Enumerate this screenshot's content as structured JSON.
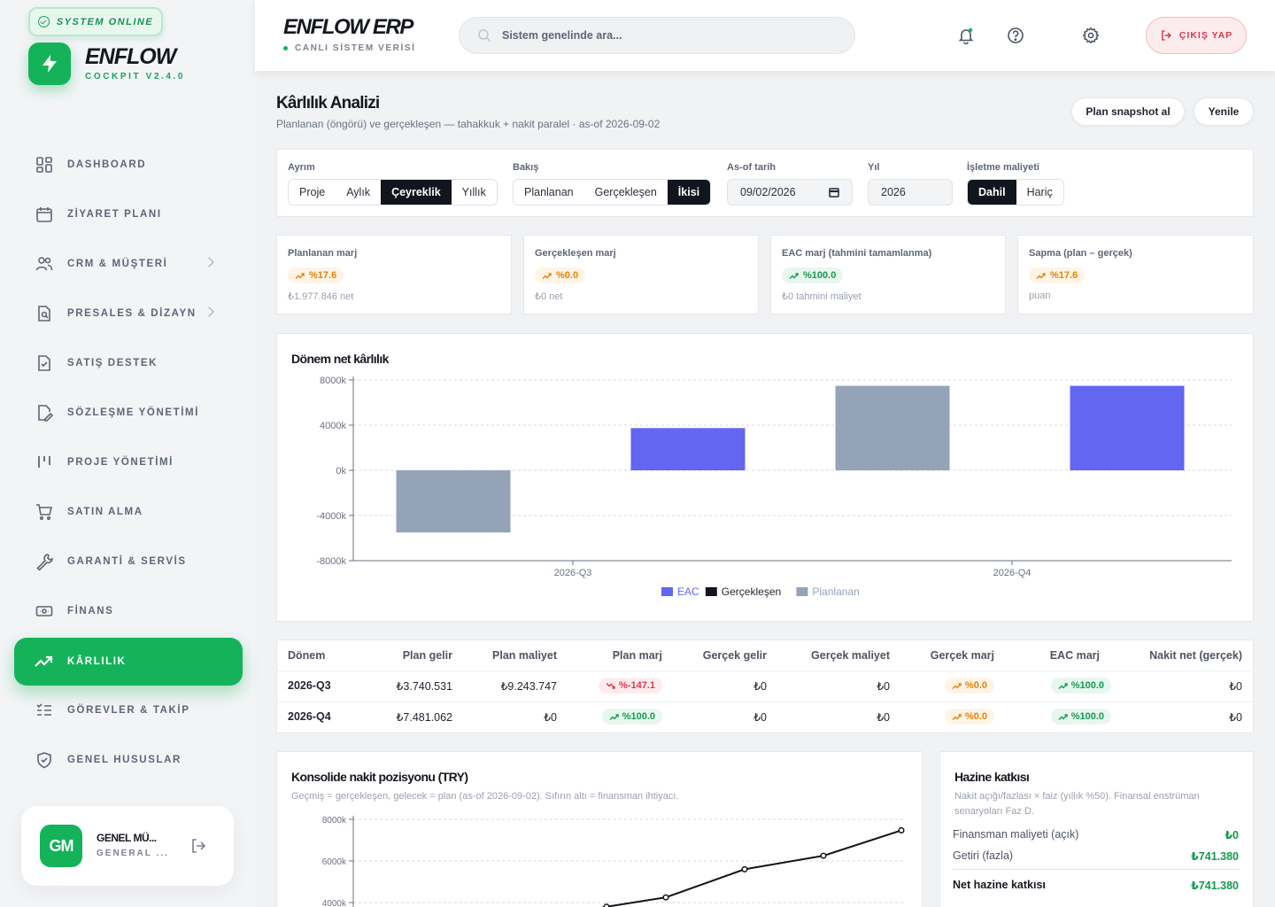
{
  "sidebar": {
    "status": "SYSTEM ONLINE",
    "brand": "ENFLOW",
    "version": "COCKPIT V2.4.0",
    "items": [
      {
        "label": "DASHBOARD"
      },
      {
        "label": "ZİYARET PLANI"
      },
      {
        "label": "CRM & MÜŞTERİ"
      },
      {
        "label": "PRESALES & DİZAYN"
      },
      {
        "label": "SATIŞ DESTEK"
      },
      {
        "label": "SÖZLEŞME YÖNETİMİ"
      },
      {
        "label": "PROJE YÖNETİMİ"
      },
      {
        "label": "SATIN ALMA"
      },
      {
        "label": "GARANTİ & SERVİS"
      },
      {
        "label": "FİNANS"
      },
      {
        "label": "KÂRLILIK"
      },
      {
        "label": "GÖREVLER & TAKİP"
      },
      {
        "label": "GENEL HUSUSLAR"
      }
    ],
    "user": {
      "initials": "GM",
      "name": "GENEL MÜ...",
      "role": "GENERAL ..."
    }
  },
  "topbar": {
    "logo": "ENFLOW ERP",
    "subtitle": "CANLI SİSTEM VERİSİ",
    "search_placeholder": "Sistem genelinde ara...",
    "logout": "ÇIKIŞ YAP"
  },
  "page": {
    "title": "Kârlılık Analizi",
    "subtitle": "Planlanan (öngörü) ve gerçekleşen — tahakkuk + nakit paralel · as-of 2026-09-02",
    "btn_snapshot": "Plan snapshot al",
    "btn_refresh": "Yenile"
  },
  "filters": {
    "ayrim_label": "Ayrım",
    "ayrim": [
      "Proje",
      "Aylık",
      "Çeyreklik",
      "Yıllık"
    ],
    "bakis_label": "Bakış",
    "bakis": [
      "Planlanan",
      "Gerçekleşen",
      "İkisi"
    ],
    "asof_label": "As-of tarih",
    "asof_value": "09/02/2026",
    "yil_label": "Yıl",
    "yil_value": "2026",
    "isletme_label": "İşletme maliyeti",
    "isletme": [
      "Dahil",
      "Hariç"
    ]
  },
  "kpis": [
    {
      "title": "Planlanan marj",
      "badge": "%17.6",
      "note": "₺1.977.846 net",
      "tone": "orange"
    },
    {
      "title": "Gerçekleşen marj",
      "badge": "%0.0",
      "note": "₺0 net",
      "tone": "orange"
    },
    {
      "title": "EAC marj (tahmini tamamlanma)",
      "badge": "%100.0",
      "note": "₺0 tahmini maliyet",
      "tone": "green"
    },
    {
      "title": "Sapma (plan – gerçek)",
      "badge": "%17.6",
      "note": "puan",
      "tone": "orange"
    }
  ],
  "chart_data": {
    "type": "bar",
    "title": "Dönem net kârlılık",
    "categories": [
      "2026-Q3",
      "2026-Q4"
    ],
    "series": [
      {
        "name": "EAC",
        "values": [
          3740.531,
          7481.062
        ],
        "color": "#6366f1"
      },
      {
        "name": "Gerçekleşen",
        "values": [
          0,
          0
        ],
        "color": "#11151d"
      },
      {
        "name": "Planlanan",
        "values": [
          -5503.216,
          7481.062
        ],
        "color": "#94a3b8"
      }
    ],
    "ylim": [
      -8000,
      8000
    ],
    "yticks": [
      "8000k",
      "4000k",
      "0k",
      "-4000k",
      "-8000k"
    ],
    "legend": "bottom",
    "grid": true
  },
  "table": {
    "headers": [
      "Dönem",
      "Plan gelir",
      "Plan maliyet",
      "Plan marj",
      "Gerçek gelir",
      "Gerçek maliyet",
      "Gerçek marj",
      "EAC marj",
      "Nakit net (gerçek)"
    ],
    "rows": [
      {
        "donem": "2026-Q3",
        "plan_gelir": "₺3.740.531",
        "plan_maliyet": "₺9.243.747",
        "plan_marj": "%-147.1",
        "plan_marj_tone": "red",
        "gercek_gelir": "₺0",
        "gercek_maliyet": "₺0",
        "gercek_marj": "%0.0",
        "eac_marj": "%100.0",
        "nakit": "₺0"
      },
      {
        "donem": "2026-Q4",
        "plan_gelir": "₺7.481.062",
        "plan_maliyet": "₺0",
        "plan_marj": "%100.0",
        "plan_marj_tone": "green",
        "gercek_gelir": "₺0",
        "gercek_maliyet": "₺0",
        "gercek_marj": "%0.0",
        "eac_marj": "%100.0",
        "nakit": "₺0"
      }
    ]
  },
  "cash": {
    "title": "Konsolide nakit pozisyonu (TRY)",
    "subtitle": "Geçmiş = gerçekleşen, gelecek = plan (as-of 2026-09-02). Sıfırın altı = finansman ihtiyacı.",
    "yticks": [
      "8000k",
      "6000k",
      "4000k"
    ],
    "line_values": [
      3500,
      3800,
      4250,
      5600,
      6250,
      7470
    ]
  },
  "treasury": {
    "title": "Hazine katkısı",
    "subtitle": "Nakit açığı/fazlası × faiz (yıllık %50). Finansal enstrüman senaryoları Faz D.",
    "rows": [
      {
        "label": "Finansman maliyeti (açık)",
        "value": "₺0"
      },
      {
        "label": "Getiri (fazla)",
        "value": "₺741.380"
      }
    ],
    "net_label": "Net hazine katkısı",
    "net_value": "₺741.380"
  }
}
